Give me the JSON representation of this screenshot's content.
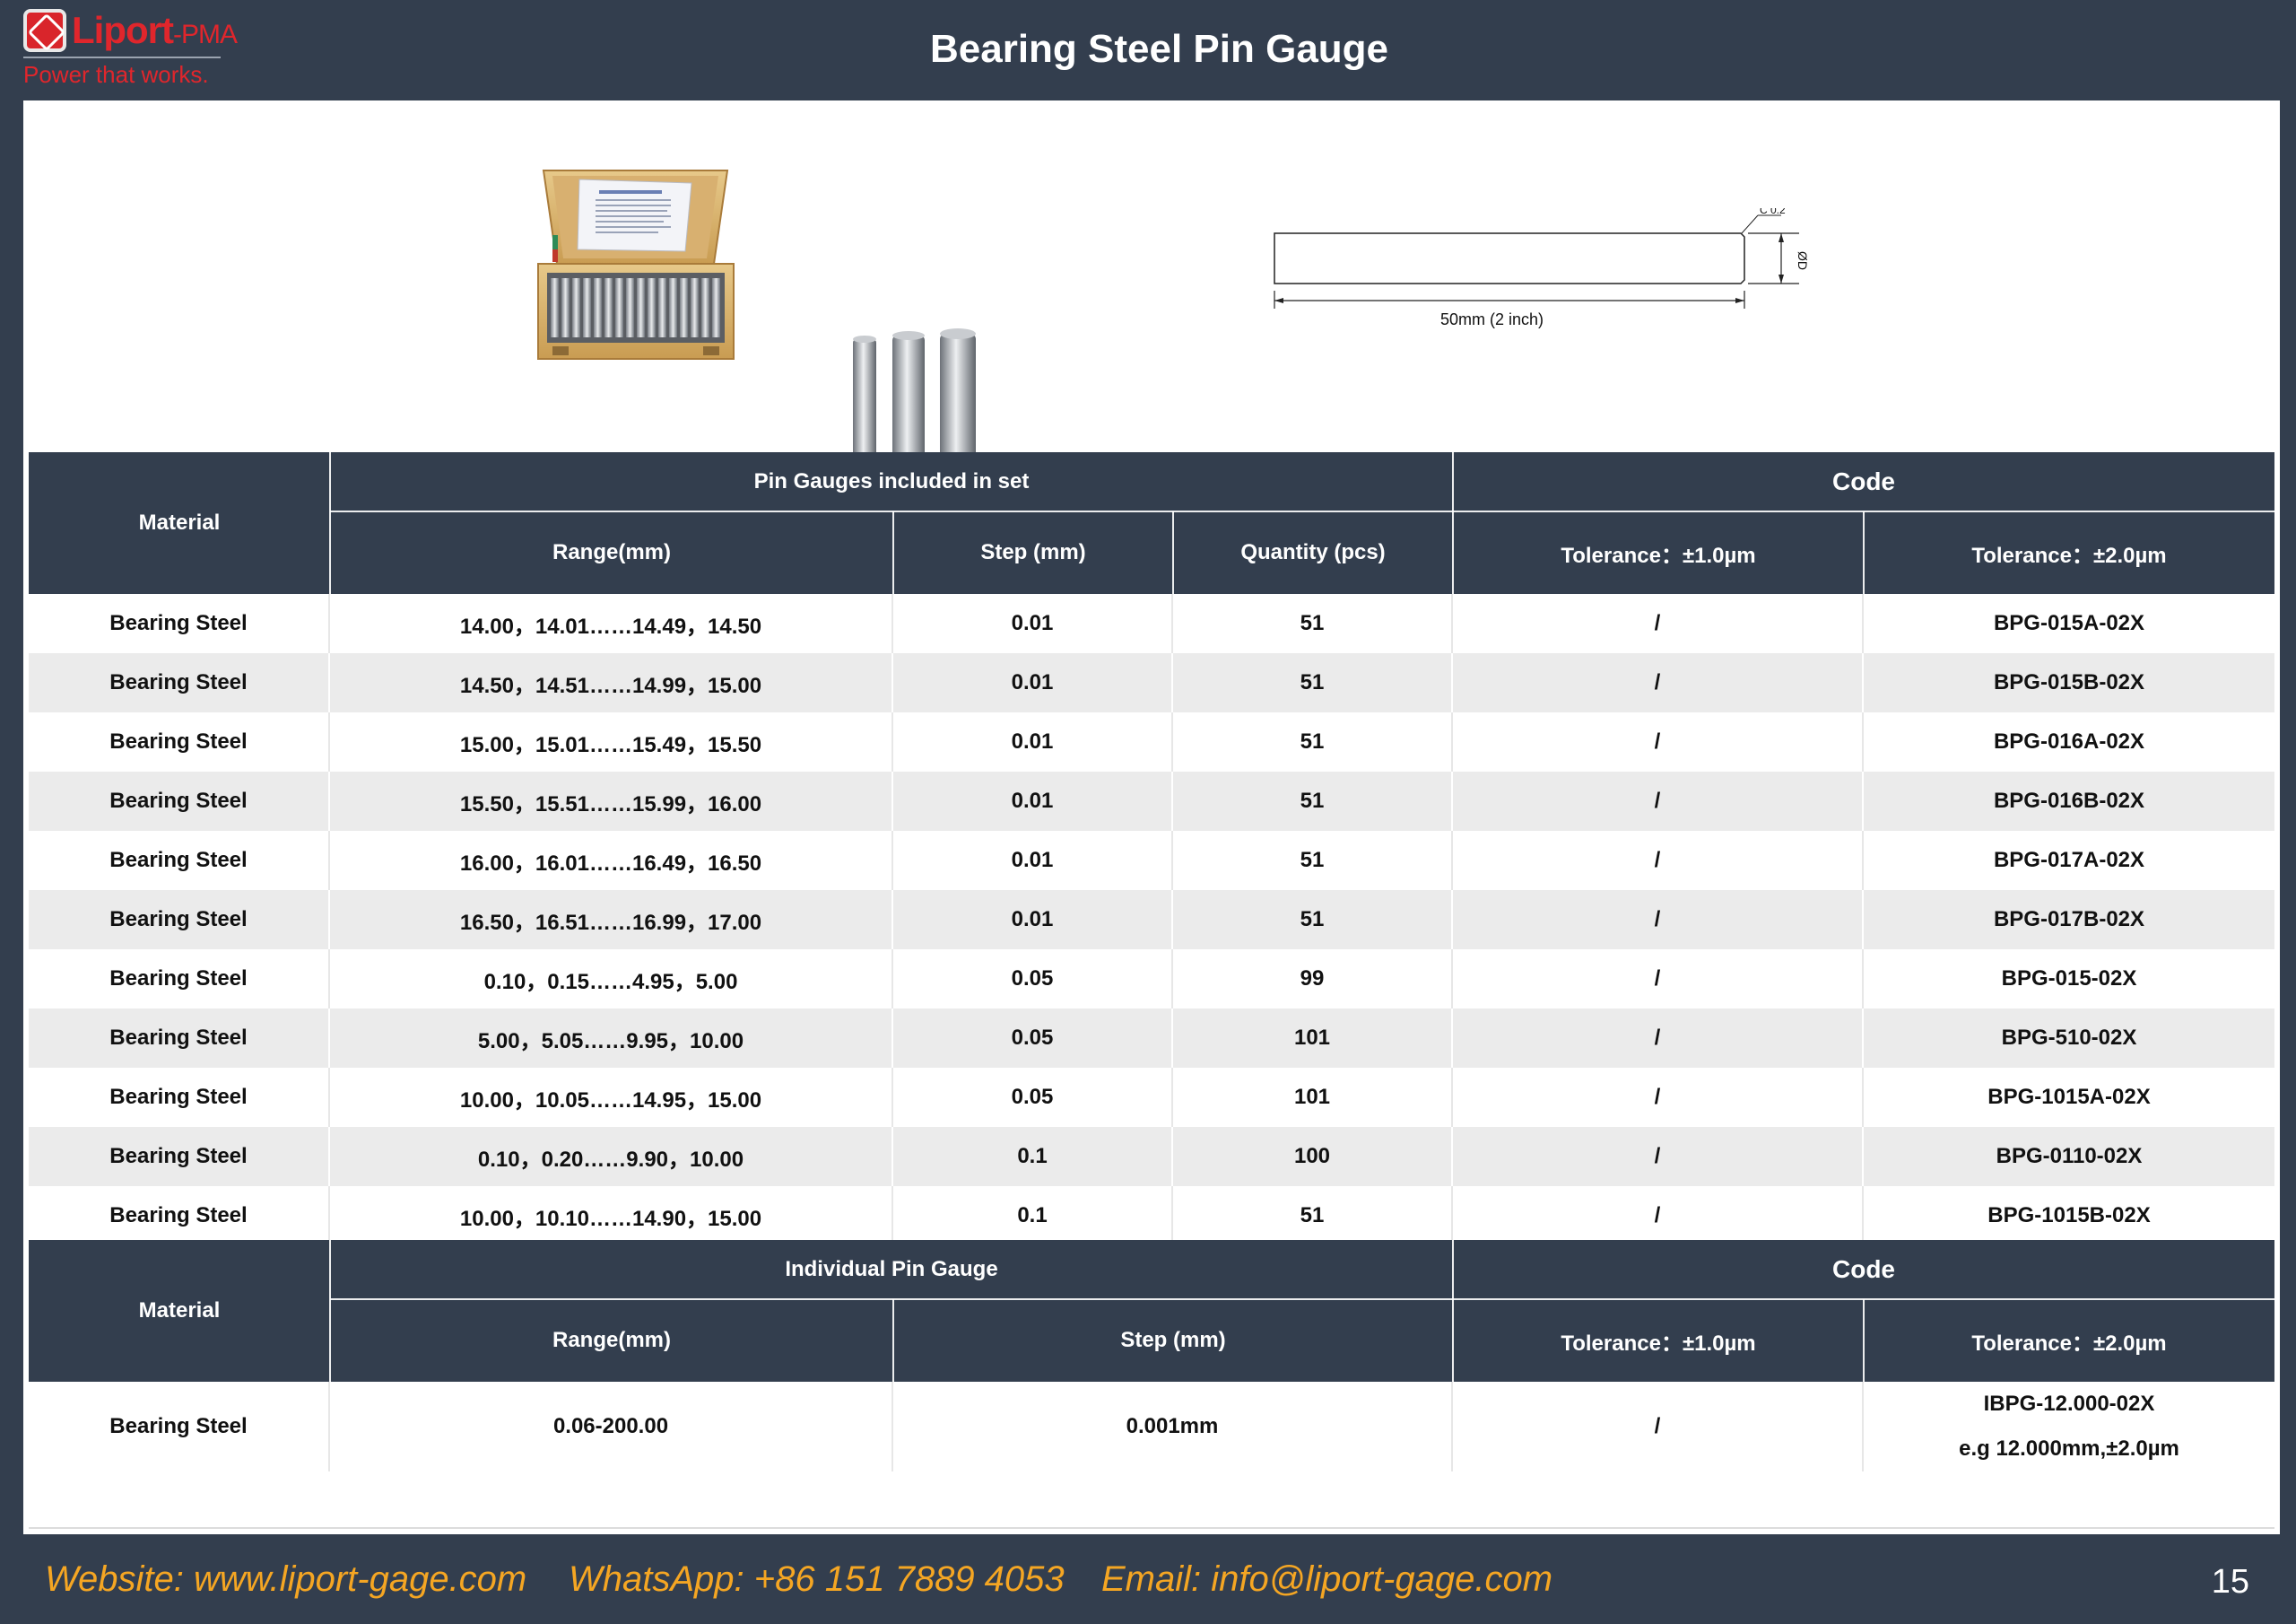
{
  "header": {
    "logo_name": "Liport",
    "logo_suffix": "-PMA",
    "logo_tagline": "Power that works.",
    "title": "Bearing Steel Pin Gauge"
  },
  "drawing": {
    "chamfer": "C 0.2",
    "diameter": "ØD",
    "length": "50mm (2 inch)"
  },
  "table1": {
    "col_material": "Material",
    "group_set": "Pin Gauges included in set",
    "group_code": "Code",
    "col_range": "Range(mm)",
    "col_step": "Step (mm)",
    "col_qty": "Quantity (pcs)",
    "col_tol1": "Tolerance：±1.0µm",
    "col_tol2": "Tolerance：±2.0µm",
    "rows": [
      {
        "material": "Bearing Steel",
        "range": "14.00，14.01……14.49，14.50",
        "step": "0.01",
        "qty": "51",
        "tol1": "/",
        "code": "BPG-015A-02X"
      },
      {
        "material": "Bearing Steel",
        "range": "14.50，14.51……14.99，15.00",
        "step": "0.01",
        "qty": "51",
        "tol1": "/",
        "code": "BPG-015B-02X"
      },
      {
        "material": "Bearing Steel",
        "range": "15.00，15.01……15.49，15.50",
        "step": "0.01",
        "qty": "51",
        "tol1": "/",
        "code": "BPG-016A-02X"
      },
      {
        "material": "Bearing Steel",
        "range": "15.50，15.51……15.99，16.00",
        "step": "0.01",
        "qty": "51",
        "tol1": "/",
        "code": "BPG-016B-02X"
      },
      {
        "material": "Bearing Steel",
        "range": "16.00，16.01……16.49，16.50",
        "step": "0.01",
        "qty": "51",
        "tol1": "/",
        "code": "BPG-017A-02X"
      },
      {
        "material": "Bearing Steel",
        "range": "16.50，16.51……16.99，17.00",
        "step": "0.01",
        "qty": "51",
        "tol1": "/",
        "code": "BPG-017B-02X"
      },
      {
        "material": "Bearing Steel",
        "range": "0.10，0.15……4.95，5.00",
        "step": "0.05",
        "qty": "99",
        "tol1": "/",
        "code": "BPG-015-02X"
      },
      {
        "material": "Bearing Steel",
        "range": "5.00，5.05……9.95，10.00",
        "step": "0.05",
        "qty": "101",
        "tol1": "/",
        "code": "BPG-510-02X"
      },
      {
        "material": "Bearing Steel",
        "range": "10.00，10.05……14.95，15.00",
        "step": "0.05",
        "qty": "101",
        "tol1": "/",
        "code": "BPG-1015A-02X"
      },
      {
        "material": "Bearing Steel",
        "range": "0.10，0.20……9.90，10.00",
        "step": "0.1",
        "qty": "100",
        "tol1": "/",
        "code": "BPG-0110-02X"
      },
      {
        "material": "Bearing Steel",
        "range": "10.00，10.10……14.90，15.00",
        "step": "0.1",
        "qty": "51",
        "tol1": "/",
        "code": "BPG-1015B-02X"
      }
    ]
  },
  "table2": {
    "col_material": "Material",
    "group_single": "Individual Pin Gauge",
    "group_code": "Code",
    "col_range": "Range(mm)",
    "col_step": "Step (mm)",
    "col_tol1": "Tolerance：±1.0µm",
    "col_tol2": "Tolerance：±2.0µm",
    "row": {
      "material": "Bearing Steel",
      "range": "0.06-200.00",
      "step": "0.001mm",
      "tol1": "/",
      "code": "IBPG-12.000-02X",
      "code_example": "e.g 12.000mm,±2.0µm"
    }
  },
  "footer": {
    "website": "Website: www.liport-gage.com",
    "whatsapp": "WhatsApp: +86 151 7889 4053",
    "email": "Email: info@liport-gage.com",
    "page_number": "15"
  }
}
